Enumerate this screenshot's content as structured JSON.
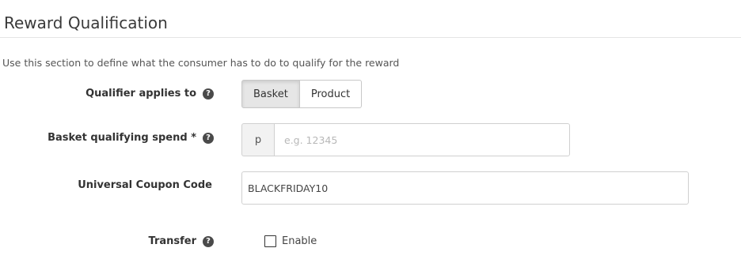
{
  "section": {
    "title": "Reward Qualification",
    "description": "Use this section to define what the consumer has to do to qualify for the reward"
  },
  "help_icon_glyph": "?",
  "qualifier": {
    "label": "Qualifier applies to",
    "options": [
      "Basket",
      "Product"
    ],
    "selected": "Basket"
  },
  "basket_spend": {
    "label": "Basket qualifying spend *",
    "addon": "p",
    "value": "",
    "placeholder": "e.g. 12345"
  },
  "coupon": {
    "label": "Universal Coupon Code",
    "value": "BLACKFRIDAY10",
    "placeholder": ""
  },
  "transfer": {
    "label": "Transfer",
    "checkbox_label": "Enable",
    "checked": false
  },
  "colors": {
    "help_icon_bg": "#4a4a4a",
    "active_button_bg": "#e6e6e6",
    "border": "#d0d0d0",
    "addon_bg": "#f2f2f2"
  }
}
